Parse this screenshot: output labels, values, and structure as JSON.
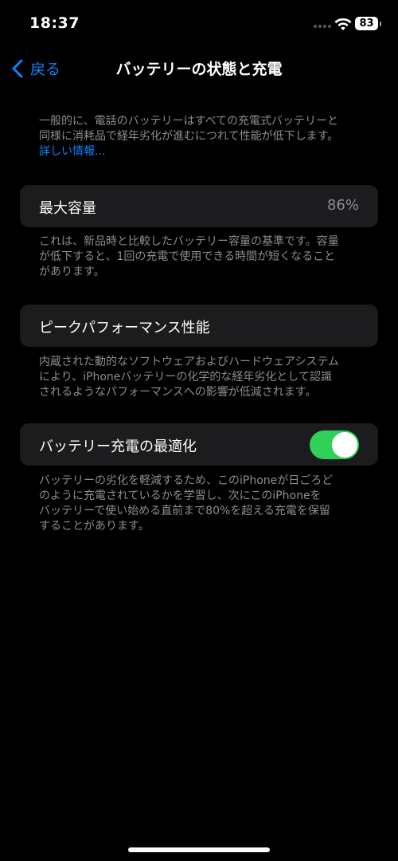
{
  "status": {
    "time": "18:37",
    "battery_level": "83"
  },
  "nav": {
    "back_label": "戻る",
    "title": "バッテリーの状態と充電"
  },
  "intro": {
    "line1": "一般的に、電話のバッテリーはすべての充電式バッテリーと",
    "line2": "同様に消耗品で経年劣化が進むにつれて性能が低下します。",
    "link": "詳しい情報..."
  },
  "max_capacity": {
    "label": "最大容量",
    "value": "86%",
    "note_line1": "これは、新品時と比較したバッテリー容量の基準です。容量",
    "note_line2": "が低下すると、1回の充電で使用できる時間が短くなること",
    "note_line3": "があります。"
  },
  "peak_performance": {
    "label": "ピークパフォーマンス性能",
    "note_line1": "内蔵された動的なソフトウェアおよびハードウェアシステム",
    "note_line2": "により、iPhoneバッテリーの化学的な経年劣化として認識",
    "note_line3": "されるようなパフォーマンスへの影響が低減されます。"
  },
  "optimized_charging": {
    "label": "バッテリー充電の最適化",
    "enabled": true,
    "note_line1": "バッテリーの劣化を軽減するため、このiPhoneが日ごろど",
    "note_line2": "のように充電されているかを学習し、次にこのiPhoneを",
    "note_line3": "バッテリーで使い始める直前まで80%を超える充電を保留",
    "note_line4": "することがあります。"
  },
  "colors": {
    "accent": "#0a84ff",
    "toggle_on": "#30d158",
    "cell_bg": "#1c1c1e",
    "secondary_text": "#8d8d93"
  }
}
